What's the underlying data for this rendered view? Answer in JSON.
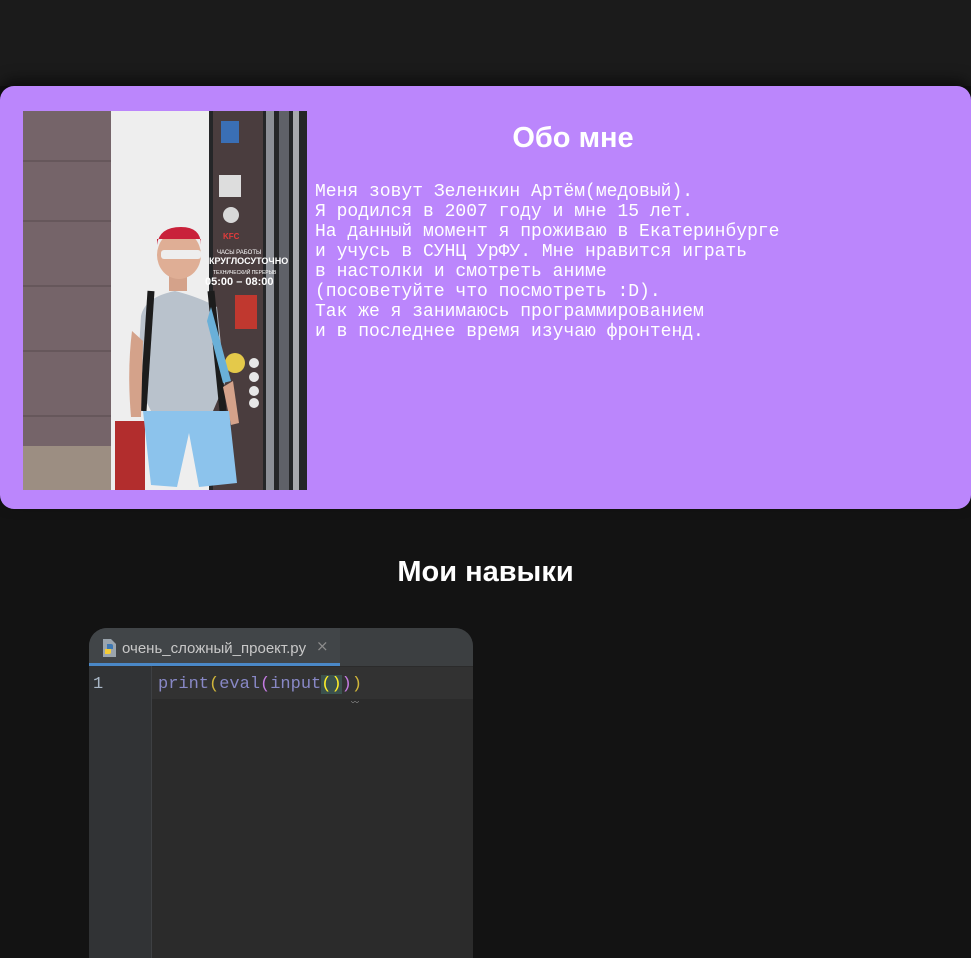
{
  "about": {
    "title": "Обо мне",
    "text": "Меня зовут Зеленкин Артём(медовый).\nЯ родился в 2007 году и мне 15 лет.\nНа данный момент я проживаю в Екатеринбурге\nи учусь в СУНЦ УрФУ. Мне нравится играть\nв настолки и смотреть аниме\n(посоветуйте что посмотреть :D).\nТак же я занимаюсь программированием\nи в последнее время изучаю фронтенд.",
    "photo_sign_lines": [
      "KFC",
      "ЧАСЫ РАБОТЫ",
      "КРУГЛОСУТОЧНО",
      "ТЕХНИЧЕСКИЙ ПЕРЕРЫВ",
      "05:00 – 08:00"
    ]
  },
  "skills": {
    "title": "Мои навыки",
    "editor": {
      "tab_label": "очень_сложный_проект.py",
      "tab_close": "×",
      "line_number": "1",
      "code": {
        "fn1": "print",
        "open1": "(",
        "fn2": "eval",
        "open2": "(",
        "fn3": "input",
        "call": "()",
        "close2": ")",
        "close1": ")"
      }
    }
  },
  "colors": {
    "page_background": "#131313",
    "card_accent": "#bb86fc",
    "editor_background": "#2b2b2b"
  }
}
